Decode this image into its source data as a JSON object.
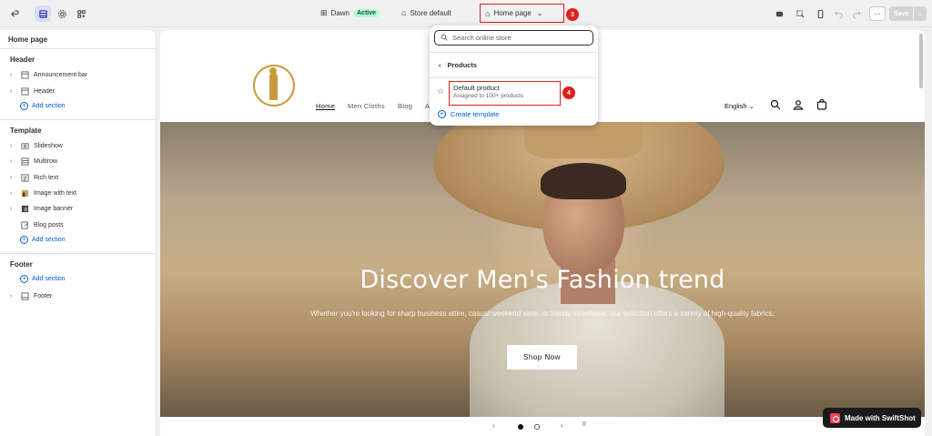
{
  "topbar": {
    "theme_name": "Dawn",
    "theme_status": "Active",
    "store_label": "Store default",
    "page_selector": "Home page",
    "save_label": "Save",
    "more_label": "···",
    "step3": "3",
    "step4": "4"
  },
  "sidebar": {
    "title": "Home page",
    "header_section": "Header",
    "header_items": [
      "Announcement bar",
      "Header"
    ],
    "template_section": "Template",
    "template_items": [
      "Slideshow",
      "Multirow",
      "Rich text",
      "Image with text",
      "Image banner",
      "Blog posts"
    ],
    "footer_section": "Footer",
    "footer_items": [
      "Footer"
    ],
    "add_section_label": "Add section"
  },
  "dropdown": {
    "search_placeholder": "Search online store",
    "back_label": "Products",
    "item_title": "Default product",
    "item_subtitle": "Assigned to 100+ products",
    "create_label": "Create template"
  },
  "store": {
    "nav": [
      "Home",
      "Men Cloths",
      "Blog",
      "A"
    ],
    "language": "English",
    "hero_title": "Discover Men's Fashion trend",
    "hero_subtitle": "Whether you're looking for sharp business attire, casual weekend wear, or trendy streetwear, our selection offers a variety of high-quality fabrics.",
    "cta_label": "Shop Now"
  },
  "slider": {
    "prev": "‹",
    "next": "›",
    "pause": "II"
  },
  "watermark": {
    "label": "Made with SwiftShot"
  },
  "colors": {
    "accent_blue": "#005bd3",
    "annotation_red": "#e0201b",
    "active_badge_bg": "#b4fed2"
  }
}
